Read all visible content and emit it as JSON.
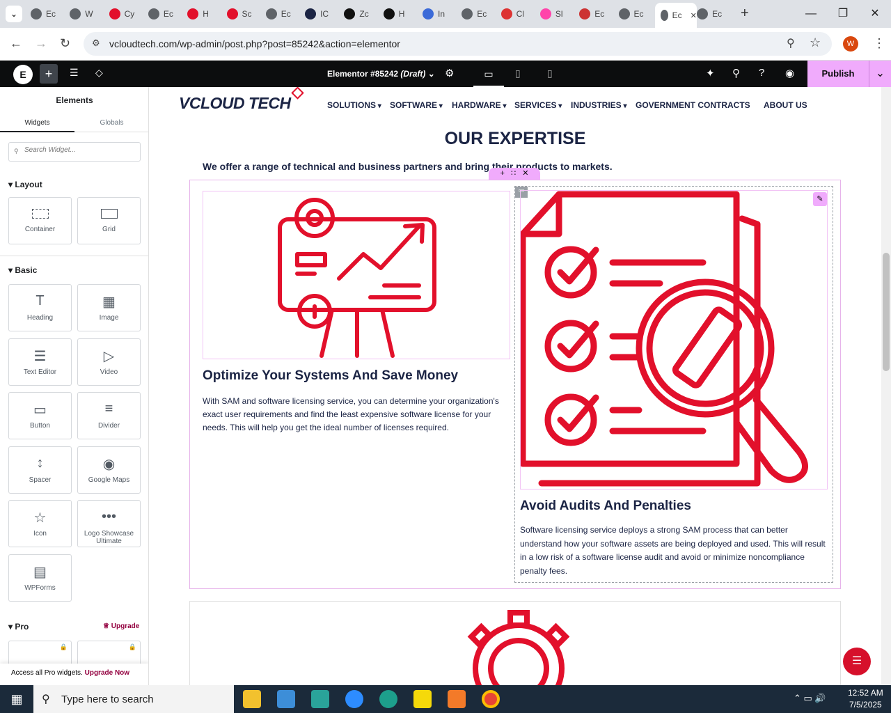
{
  "browser": {
    "tabs": [
      {
        "label": "Ec",
        "color": "#5f6368"
      },
      {
        "label": "W",
        "color": "#5f6368"
      },
      {
        "label": "Cy",
        "color": "#e2102b"
      },
      {
        "label": "Ec",
        "color": "#5f6368"
      },
      {
        "label": "H",
        "color": "#e2102b"
      },
      {
        "label": "Sc",
        "color": "#e2102b"
      },
      {
        "label": "Ec",
        "color": "#5f6368"
      },
      {
        "label": "IC",
        "color": "#1b2444"
      },
      {
        "label": "Zc",
        "color": "#111"
      },
      {
        "label": "H",
        "color": "#111"
      },
      {
        "label": "In",
        "color": "#3b6ad8"
      },
      {
        "label": "Ec",
        "color": "#5f6368"
      },
      {
        "label": "Cl",
        "color": "#d33"
      },
      {
        "label": "Sl",
        "color": "#f4a"
      },
      {
        "label": "Ec",
        "color": "#c33"
      },
      {
        "label": "Ec",
        "color": "#5f6368"
      },
      {
        "label": "Ec",
        "color": "#5f6368",
        "active": true
      },
      {
        "label": "Ec",
        "color": "#5f6368"
      }
    ],
    "url": "vcloudtech.com/wp-admin/post.php?post=85242&action=elementor",
    "profile_initial": "W"
  },
  "elementor": {
    "doc_title": "Elementor #85242",
    "doc_status": "(Draft)",
    "publish_label": "Publish"
  },
  "panel": {
    "title": "Elements",
    "tabs": [
      "Widgets",
      "Globals"
    ],
    "search_placeholder": "Search Widget...",
    "layout_label": "Layout",
    "basic_label": "Basic",
    "pro_label": "Pro",
    "upgrade_label": "Upgrade",
    "layout_widgets": [
      "Container",
      "Grid"
    ],
    "basic_widgets": [
      "Heading",
      "Image",
      "Text Editor",
      "Video",
      "Button",
      "Divider",
      "Spacer",
      "Google Maps",
      "Icon",
      "Logo Showcase Ultimate",
      "WPForms"
    ],
    "footer_text": "Access all Pro widgets.",
    "footer_link": "Upgrade Now"
  },
  "site": {
    "logo": "VCLOUD TECH",
    "menu": [
      "SOLUTIONS",
      "SOFTWARE",
      "HARDWARE",
      "SERVICES",
      "INDUSTRIES",
      "GOVERNMENT CONTRACTS",
      "ABOUT US"
    ],
    "heading": "OUR EXPERTISE",
    "subheading": "We offer a range of technical and business partners and bring their products to markets.",
    "card1_title": "Optimize Your Systems And Save Money",
    "card1_text": "With SAM and software licensing service, you can determine your organization's exact user requirements and find the least expensive software license for your needs. This will help you get the ideal number of licenses required.",
    "card2_title": "Avoid Audits And Penalties",
    "card2_text": "Software licensing service deploys a strong SAM process that can better understand how your software assets are being deployed and used. This will result in a low risk of a software license audit and avoid or minimize noncompliance penalty fees.",
    "accent": "#e2102b"
  },
  "taskbar": {
    "search_placeholder": "Type here to search",
    "time": "12:52 AM",
    "date": "7/5/2025"
  }
}
